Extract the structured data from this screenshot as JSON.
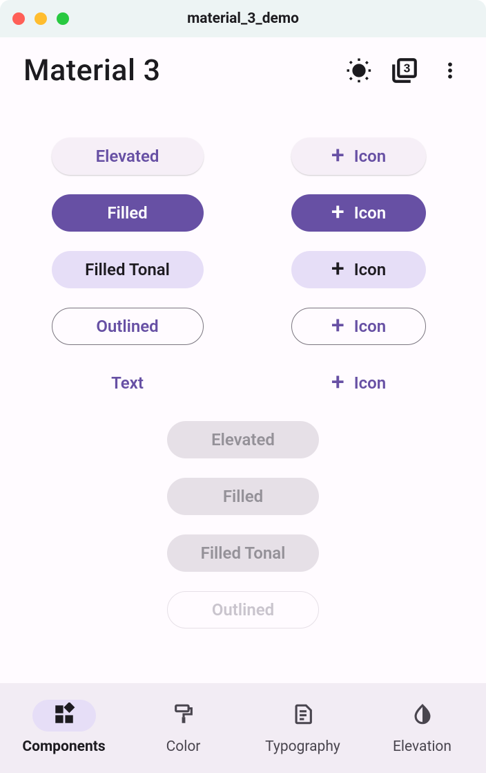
{
  "window": {
    "title": "material_3_demo"
  },
  "appbar": {
    "title": "Material 3"
  },
  "buttons": {
    "elevated": "Elevated",
    "filled": "Filled",
    "tonal": "Filled Tonal",
    "outlined": "Outlined",
    "text": "Text",
    "icon_label": "Icon"
  },
  "disabled": {
    "elevated": "Elevated",
    "filled": "Filled",
    "tonal": "Filled Tonal",
    "outlined": "Outlined"
  },
  "nav": {
    "components": "Components",
    "color": "Color",
    "typography": "Typography",
    "elevation": "Elevation"
  },
  "colors": {
    "primary": "#6750a4",
    "surface": "#fffbff",
    "secondary_container": "#e6def7",
    "nav_bg": "#f2ecf4"
  }
}
